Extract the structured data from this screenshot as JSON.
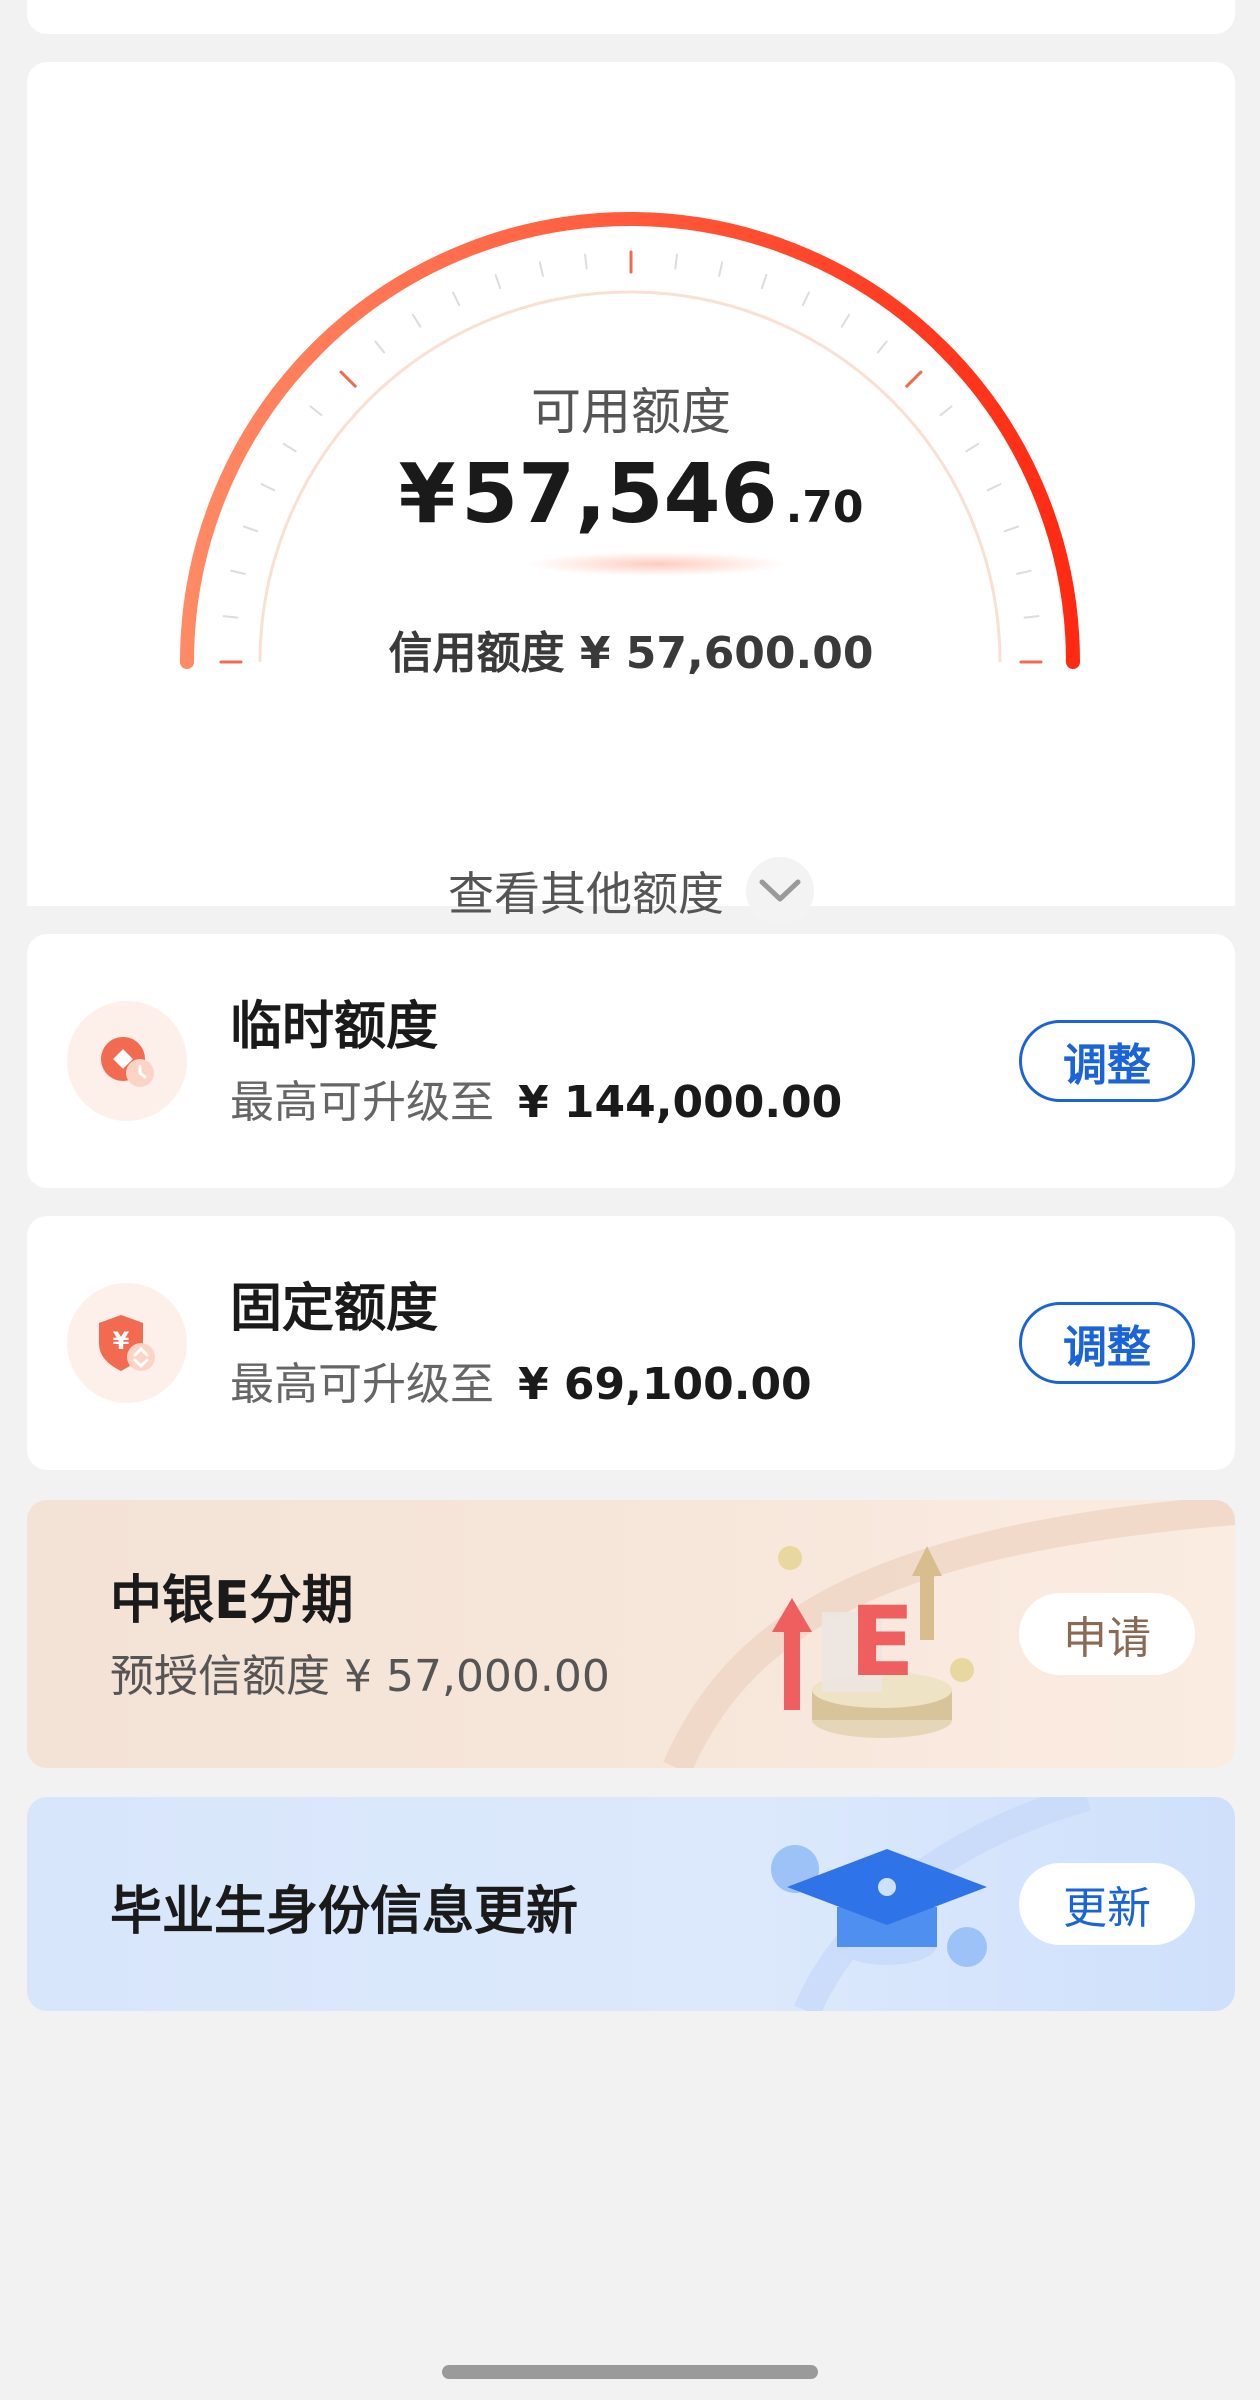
{
  "quota": {
    "label": "可用额度",
    "currency": "¥",
    "amount_integer": "57,546",
    "amount_decimal": ".70",
    "credit_line": "信用额度 ¥ 57,600.00",
    "more_label": "查看其他额度"
  },
  "temp_quota": {
    "title": "临时额度",
    "sub_prefix": "最高可升级至",
    "sub_value": "¥ 144,000.00",
    "button": "调整"
  },
  "fixed_quota": {
    "title": "固定额度",
    "sub_prefix": "最高可升级至",
    "sub_value": "¥ 69,100.00",
    "button": "调整"
  },
  "installment": {
    "title": "中银E分期",
    "subtitle": "预授信额度 ¥ 57,000.00",
    "button": "申请"
  },
  "graduate": {
    "title": "毕业生身份信息更新",
    "button": "更新"
  },
  "colors": {
    "accent_blue": "#1a63d8",
    "gauge_start": "#ff8a65",
    "gauge_end": "#ff2a12"
  },
  "icons": {
    "temp_quota": "coin-clock-icon",
    "fixed_quota": "shield-yuan-icon",
    "more": "chevron-down-icon",
    "installment": "e-installment-illustration",
    "graduate": "graduation-cap-illustration"
  }
}
